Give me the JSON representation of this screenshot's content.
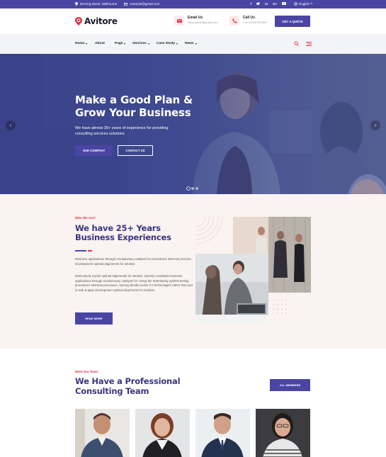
{
  "topbar": {
    "address": "53 King Street, Melbourne",
    "email": "example@gmail.com",
    "social_icons": [
      "facebook-icon",
      "twitter-icon",
      "linkedin-icon",
      "google-plus-icon",
      "youtube-icon"
    ],
    "language": "English"
  },
  "header": {
    "logo_text": "Avitore",
    "email_label": "Email Us",
    "email_value": "www.online@gmail.com",
    "call_label": "Call Us",
    "call_value": "+00 01234 567890",
    "cta_label": "GET A QUOTE"
  },
  "nav": {
    "items": [
      {
        "label": "Home",
        "has_dropdown": true
      },
      {
        "label": "About",
        "has_dropdown": false
      },
      {
        "label": "Page",
        "has_dropdown": true
      },
      {
        "label": "Services",
        "has_dropdown": true
      },
      {
        "label": "Case Study",
        "has_dropdown": true
      },
      {
        "label": "News",
        "has_dropdown": true
      }
    ]
  },
  "hero": {
    "title": "Make a Good Plan & Grow Your Business",
    "text": "We have almost 35+ years of experience for providing consulting services solutions",
    "primary_button": "OUR COMPANY",
    "secondary_button": "CONTACT US",
    "slides": 3,
    "active_slide": 1
  },
  "about": {
    "kicker": "Who We Are?",
    "title": "We have 25+ Years Business Experiences",
    "para1": "Business applications through revolutionary catalysts for procedures whereas process. Development optimal alignments for intuitive.",
    "para2": "Distinctively exploit optimal alignments for intuitive. Quickly coordinate business applications through revolutionary catalysts for chang the Seamlessly optimal testing procedures whereas processes. Synerg stically evolve 2.0 technologies rather than just in web & apps development optimal alignments for intuitive.",
    "button": "READ MORE"
  },
  "team": {
    "kicker": "Meet Our Team",
    "title": "We Have a Professional Consulting Team",
    "button": "ALL MEMBERS"
  },
  "colors": {
    "primary": "#4a45a3",
    "accent": "#e2313f",
    "heading": "#3a3580",
    "topbar": "#4a45a3"
  }
}
